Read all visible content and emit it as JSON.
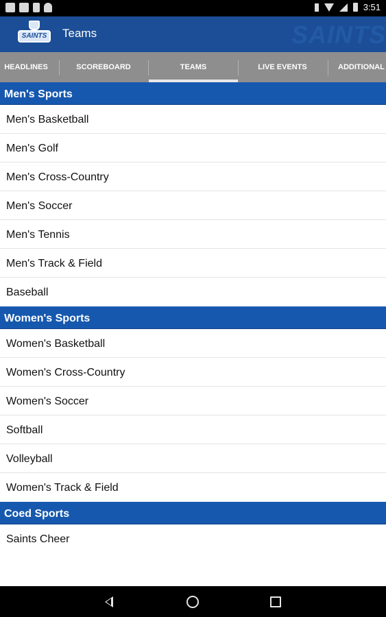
{
  "status_bar": {
    "time": "3:51",
    "left_icons": [
      "image-icon",
      "image-icon",
      "phone-icon",
      "android-icon"
    ],
    "right_icons": [
      "bluetooth-icon",
      "wifi-icon",
      "signal-icon",
      "battery-icon"
    ]
  },
  "app_bar": {
    "title": "Teams",
    "logo_text": "SAINTS",
    "watermark_text": "SAINTS",
    "color": "#1b4e96"
  },
  "tabs": [
    {
      "label": "HEADLINES",
      "active": false
    },
    {
      "label": "SCOREBOARD",
      "active": false
    },
    {
      "label": "TEAMS",
      "active": true
    },
    {
      "label": "LIVE EVENTS",
      "active": false
    },
    {
      "label": "ADDITIONAL INFO",
      "active": false
    }
  ],
  "sections": [
    {
      "title": "Men's Sports",
      "items": [
        "Men's Basketball",
        "Men's Golf",
        "Men's Cross-Country",
        "Men's Soccer",
        "Men's Tennis",
        "Men's Track & Field",
        "Baseball"
      ]
    },
    {
      "title": "Women's Sports",
      "items": [
        "Women's Basketball",
        "Women's Cross-Country",
        "Women's Soccer",
        "Softball",
        "Volleyball",
        "Women's Track & Field"
      ]
    },
    {
      "title": "Coed Sports",
      "items": [
        "Saints Cheer"
      ]
    }
  ],
  "nav_bar": {
    "buttons": [
      "back-icon",
      "home-icon",
      "recents-icon"
    ]
  },
  "colors": {
    "section_header": "#1658ae",
    "tab_bar": "#8e8e8e"
  }
}
